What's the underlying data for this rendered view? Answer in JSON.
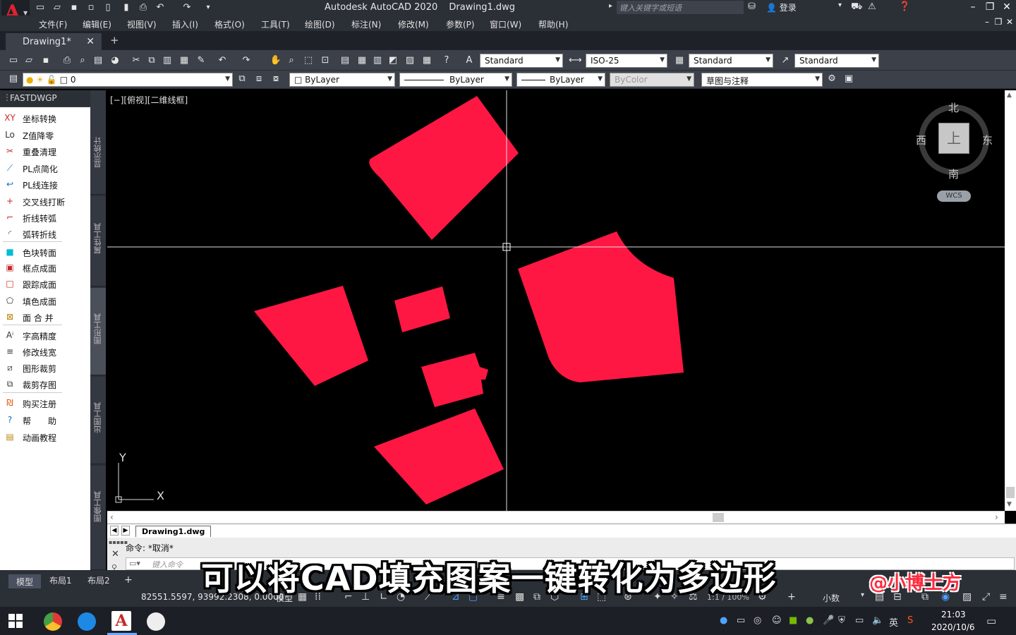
{
  "titlebar": {
    "app_name": "Autodesk AutoCAD 2020",
    "file_name": "Drawing1.dwg",
    "search_placeholder": "键入关键字或短语",
    "login_label": "登录"
  },
  "menu": [
    "文件(F)",
    "编辑(E)",
    "视图(V)",
    "插入(I)",
    "格式(O)",
    "工具(T)",
    "绘图(D)",
    "标注(N)",
    "修改(M)",
    "参数(P)",
    "窗口(W)",
    "帮助(H)"
  ],
  "document_tab": {
    "label": "Drawing1*"
  },
  "toolbar1": {
    "text_style": "Standard",
    "dim_style": "ISO-25",
    "table_style": "Standard",
    "multileader_style": "Standard"
  },
  "toolbar2": {
    "layer": "0",
    "color": "ByLayer",
    "linetype": "ByLayer",
    "lineweight": "ByLayer",
    "plot_style": "ByColor",
    "workspace": "草图与注释"
  },
  "palette": {
    "title": "FASTDWGP",
    "items": [
      {
        "icon": "XY",
        "label": "坐标转换"
      },
      {
        "icon": "Lo",
        "label": "Z值降零"
      },
      {
        "icon": "✂",
        "label": "重叠清理"
      },
      {
        "icon": "⟋",
        "label": "PL点简化"
      },
      {
        "icon": "↩",
        "label": "PL线连接"
      },
      {
        "icon": "+",
        "label": "交叉线打断"
      },
      {
        "icon": "⌐",
        "label": "折线转弧"
      },
      {
        "icon": "◜",
        "label": "弧转折线"
      },
      {
        "icon": "■",
        "label": "色块转面"
      },
      {
        "icon": "▣",
        "label": "框点成面"
      },
      {
        "icon": "□",
        "label": "跟踪成面"
      },
      {
        "icon": "⬠",
        "label": "填色成面"
      },
      {
        "icon": "⊠",
        "label": "面 合 并"
      },
      {
        "icon": "Aⁱ",
        "label": "字高精度"
      },
      {
        "icon": "≡",
        "label": "修改线宽"
      },
      {
        "icon": "⧄",
        "label": "图形裁剪"
      },
      {
        "icon": "⧉",
        "label": "裁剪存图"
      },
      {
        "icon": "₪",
        "label": "购买注册"
      },
      {
        "icon": "?",
        "label": "帮　　助"
      },
      {
        "icon": "▤",
        "label": "动画教程"
      }
    ]
  },
  "side_tabs": [
    "显示统计",
    "属性工具",
    "图形工具",
    "出图工具",
    "图像工具"
  ],
  "viewport": {
    "label": "[−][俯视][二维线框]",
    "compass": {
      "north": "北",
      "south": "南",
      "east": "东",
      "west": "西",
      "top": "上"
    },
    "wcs": "WCS",
    "ucs_x": "X",
    "ucs_y": "Y"
  },
  "layout_tab": "Drawing1.dwg",
  "command": {
    "history": "命令: *取消*",
    "placeholder": "键入命令"
  },
  "status": {
    "tabs": [
      "模型",
      "布局1",
      "布局2"
    ],
    "coords": "82551.5597, 93992.2308, 0.0000",
    "model_label": "模型",
    "scale": "1:1 / 100%",
    "units": "小数"
  },
  "taskbar": {
    "time": "21:03",
    "date": "2020/10/6",
    "ime": "英"
  },
  "overlay": {
    "subtitle": "可以将CAD填充图案一键转化为多边形",
    "watermark": "@小博士方"
  },
  "colors": {
    "hatch_fill": "#ff1744",
    "canvas_bg": "#000000",
    "ui_dark": "#2b2f36"
  }
}
